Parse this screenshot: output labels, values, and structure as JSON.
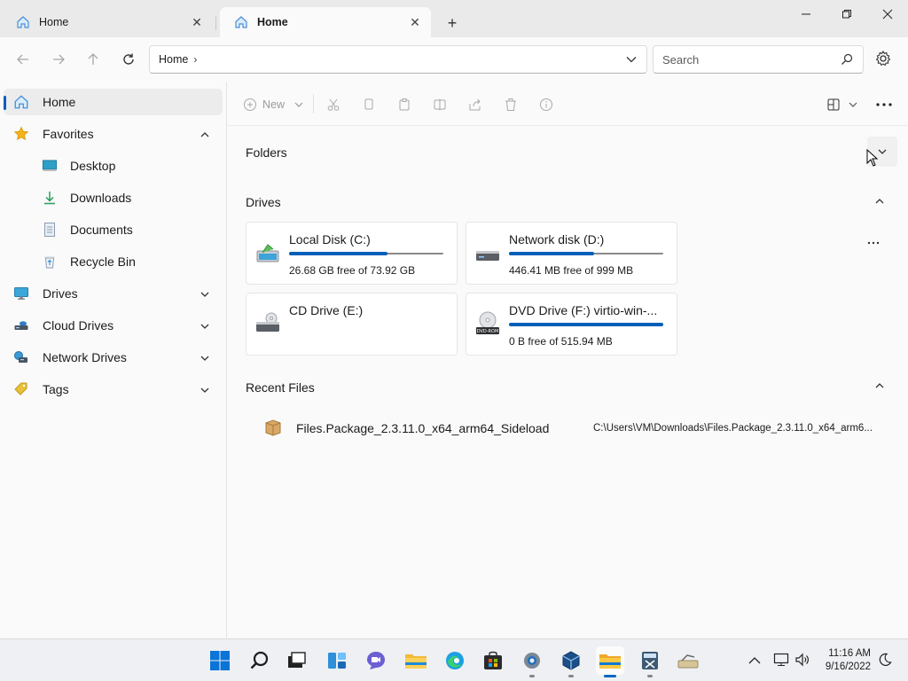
{
  "tabs": [
    {
      "label": "Home",
      "icon": "home-icon",
      "active": false
    },
    {
      "label": "Home",
      "icon": "home-icon",
      "active": true
    }
  ],
  "window_controls": {
    "minimize_icon": "minimize-icon",
    "maximize_icon": "restore-icon",
    "close_icon": "close-icon"
  },
  "address": {
    "crumb": "Home",
    "separator": "›"
  },
  "search": {
    "placeholder": "Search"
  },
  "sidebar": {
    "items": [
      {
        "label": "Home",
        "icon": "home-icon",
        "selected": true
      },
      {
        "label": "Favorites",
        "icon": "star-icon",
        "expanded": true
      },
      {
        "label": "Desktop",
        "icon": "desktop-icon",
        "indent": true
      },
      {
        "label": "Downloads",
        "icon": "download-icon",
        "indent": true
      },
      {
        "label": "Documents",
        "icon": "document-icon",
        "indent": true
      },
      {
        "label": "Recycle Bin",
        "icon": "recycle-bin-icon",
        "indent": true
      },
      {
        "label": "Drives",
        "icon": "monitor-icon",
        "expanded": false
      },
      {
        "label": "Cloud Drives",
        "icon": "cloud-drive-icon",
        "expanded": false
      },
      {
        "label": "Network Drives",
        "icon": "network-drive-icon",
        "expanded": false
      },
      {
        "label": "Tags",
        "icon": "tag-icon",
        "expanded": false
      }
    ]
  },
  "toolbar": {
    "new_label": "New"
  },
  "sections": {
    "folders": "Folders",
    "drives": "Drives",
    "recent": "Recent Files"
  },
  "drives": [
    {
      "name": "Local Disk (C:)",
      "free": "26.68 GB free of 73.92 GB",
      "used_fraction": 0.64,
      "icon": "system-drive-icon"
    },
    {
      "name": "Network disk (D:)",
      "free": "446.41 MB free of 999 MB",
      "used_fraction": 0.55,
      "icon": "network-disk-icon"
    },
    {
      "name": "CD Drive (E:)",
      "free": "",
      "used_fraction": null,
      "icon": "cd-drive-icon"
    },
    {
      "name": "DVD Drive (F:) virtio-win-...",
      "free": "0 B free of 515.94 MB",
      "used_fraction": 1.0,
      "icon": "dvd-drive-icon"
    }
  ],
  "recent_files": [
    {
      "name": "Files.Package_2.3.11.0_x64_arm64_Sideload",
      "path": "C:\\Users\\VM\\Downloads\\Files.Package_2.3.11.0_x64_arm6...",
      "icon": "package-icon"
    }
  ],
  "taskbar": {
    "apps": [
      "start-icon",
      "search-icon",
      "task-view-icon",
      "widgets-icon",
      "chat-icon",
      "file-explorer-icon",
      "edge-icon",
      "store-icon",
      "settings-icon",
      "virtualbox-icon",
      "files-app-icon",
      "calculator-icon",
      "drive-app-icon"
    ],
    "time": "11:16 AM",
    "date": "9/16/2022"
  },
  "colors": {
    "accent": "#005fb8",
    "drive_bar_track": "#8a8a8a"
  }
}
